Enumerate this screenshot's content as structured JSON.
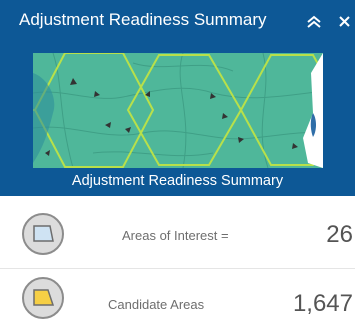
{
  "header": {
    "title": "Adjustment Readiness Summary",
    "collapse_label": "collapse",
    "close_label": "close"
  },
  "map": {
    "caption": "Adjustment Readiness Summary"
  },
  "rows": [
    {
      "label": "Areas of Interest =",
      "value": "26",
      "icon": "area-of-interest-icon",
      "fill_color": "#cfe3f3"
    },
    {
      "label": "Candidate Areas",
      "value": "1,647",
      "icon": "candidate-area-icon",
      "fill_color": "#f6cf45"
    }
  ],
  "colors": {
    "header_bg": "#0d5896",
    "map_fill": "#4fb79a",
    "hex_outline": "#b8e04a"
  }
}
